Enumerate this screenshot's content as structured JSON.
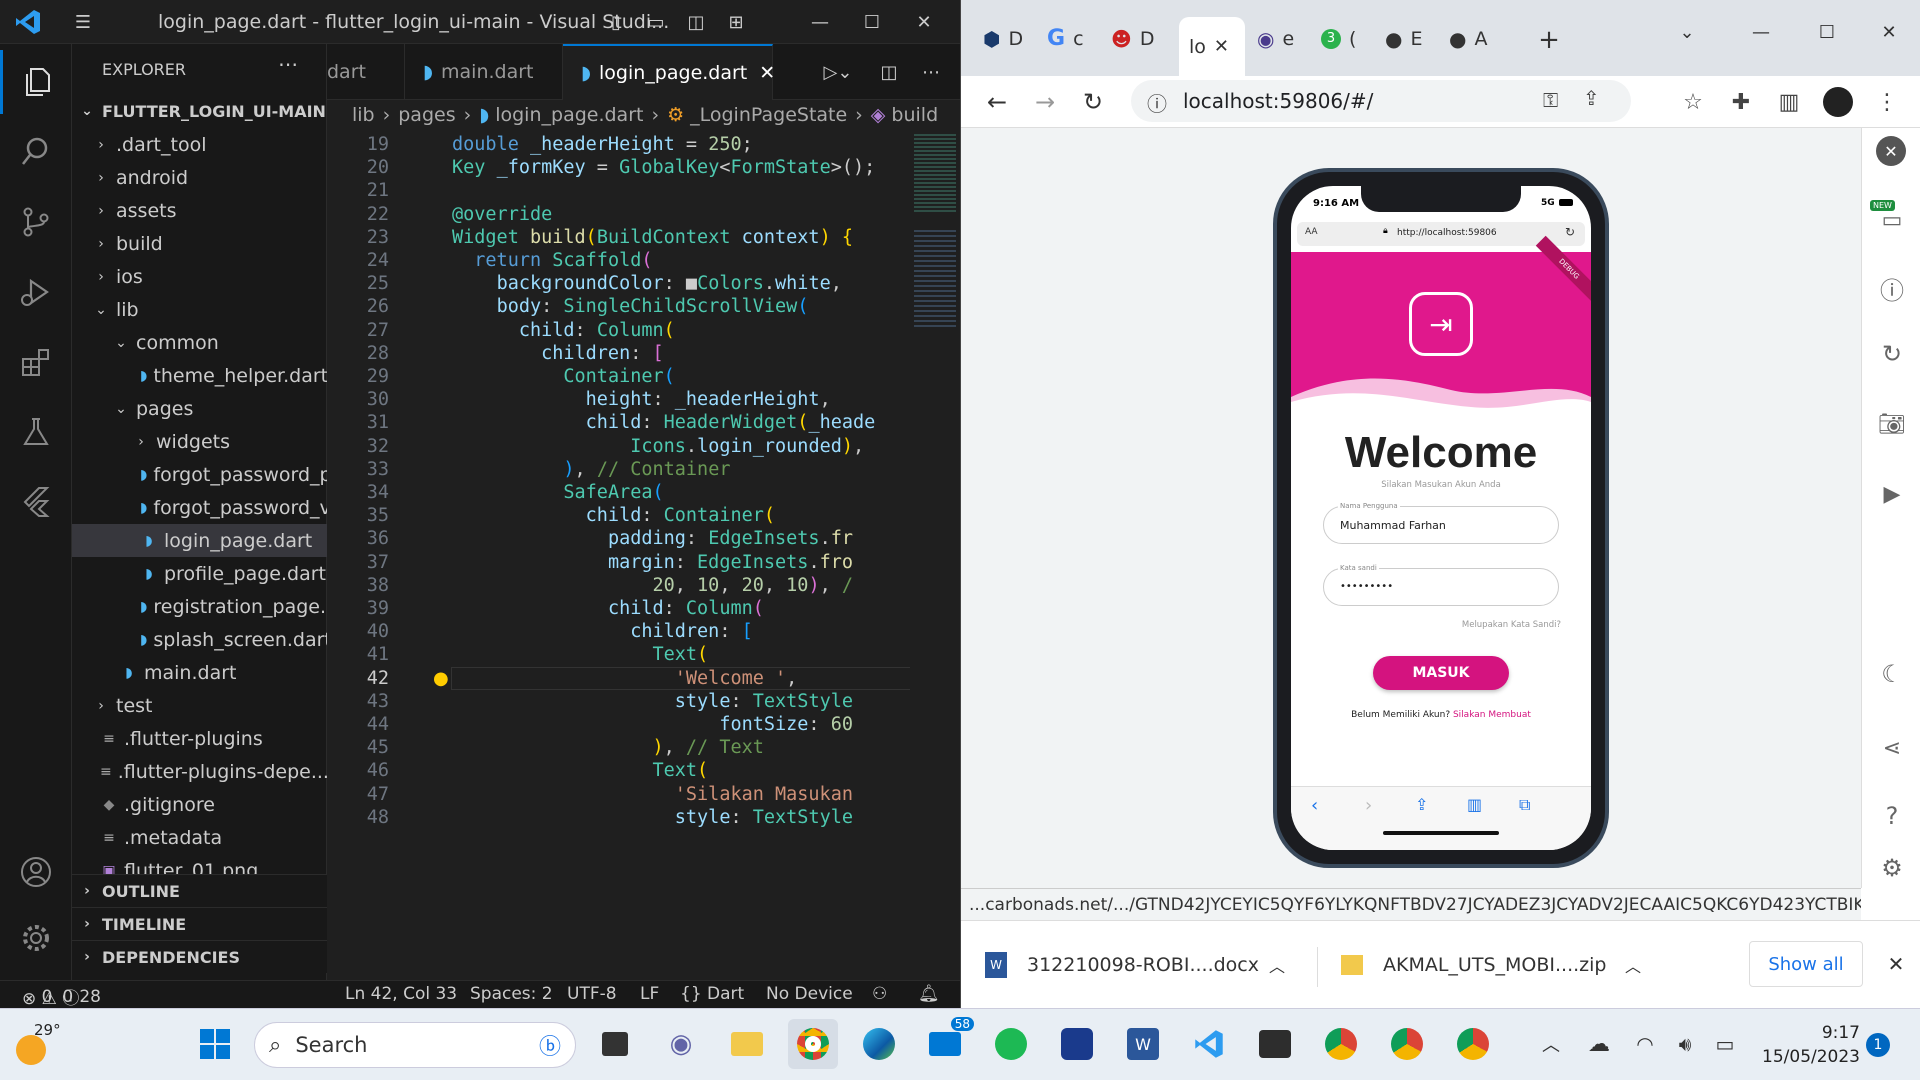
{
  "vscode": {
    "title": "login_page.dart - flutter_login_ui-main - Visual Studi...",
    "explorer_label": "EXPLORER",
    "project": "FLUTTER_LOGIN_UI-MAIN",
    "tree": [
      {
        "label": ".dart_tool",
        "type": "folder",
        "depth": 1,
        "open": false
      },
      {
        "label": "android",
        "type": "folder",
        "depth": 1,
        "open": false
      },
      {
        "label": "assets",
        "type": "folder",
        "depth": 1,
        "open": false
      },
      {
        "label": "build",
        "type": "folder",
        "depth": 1,
        "open": false
      },
      {
        "label": "ios",
        "type": "folder",
        "depth": 1,
        "open": false
      },
      {
        "label": "lib",
        "type": "folder",
        "depth": 1,
        "open": true
      },
      {
        "label": "common",
        "type": "folder",
        "depth": 2,
        "open": true
      },
      {
        "label": "theme_helper.dart",
        "type": "dart",
        "depth": 3
      },
      {
        "label": "pages",
        "type": "folder",
        "depth": 2,
        "open": true
      },
      {
        "label": "widgets",
        "type": "folder",
        "depth": 3,
        "open": false
      },
      {
        "label": "forgot_password_p...",
        "type": "dart",
        "depth": 3
      },
      {
        "label": "forgot_password_v...",
        "type": "dart",
        "depth": 3
      },
      {
        "label": "login_page.dart",
        "type": "dart",
        "depth": 3,
        "selected": true
      },
      {
        "label": "profile_page.dart",
        "type": "dart",
        "depth": 3
      },
      {
        "label": "registration_page....",
        "type": "dart",
        "depth": 3
      },
      {
        "label": "splash_screen.dart",
        "type": "dart",
        "depth": 3
      },
      {
        "label": "main.dart",
        "type": "dart",
        "depth": 2
      },
      {
        "label": "test",
        "type": "folder",
        "depth": 1,
        "open": false
      },
      {
        "label": ".flutter-plugins",
        "type": "file",
        "depth": 1
      },
      {
        "label": ".flutter-plugins-depe...",
        "type": "file",
        "depth": 1
      },
      {
        "label": ".gitignore",
        "type": "git",
        "depth": 1
      },
      {
        "label": ".metadata",
        "type": "file",
        "depth": 1
      },
      {
        "label": "flutter_01.png",
        "type": "image",
        "depth": 1
      }
    ],
    "sections": [
      "OUTLINE",
      "TIMELINE",
      "DEPENDENCIES"
    ],
    "tabs": [
      {
        "label": "dart",
        "active": false
      },
      {
        "label": "main.dart",
        "active": false
      },
      {
        "label": "login_page.dart",
        "active": true
      }
    ],
    "breadcrumb": [
      "lib",
      "pages",
      "login_page.dart",
      "_LoginPageState",
      "build"
    ],
    "code_lines": [
      {
        "n": "19",
        "html": "<span class='kw'>double</span> <span class='vr'>_headerHeight</span> = <span class='nm'>250</span>;"
      },
      {
        "n": "20",
        "html": "<span class='ty'>Key</span> <span class='vr'>_formKey</span> = <span class='ty'>GlobalKey</span>&lt;<span class='ty'>FormState</span>&gt;();"
      },
      {
        "n": "21",
        "html": ""
      },
      {
        "n": "22",
        "html": "<span class='ty'>@override</span>"
      },
      {
        "n": "23",
        "html": "<span class='ty'>Widget</span> <span class='fn'>build</span><span class='br1'>(</span><span class='ty'>BuildContext</span> <span class='vr'>context</span><span class='br1'>)</span> <span class='br1'>{</span>"
      },
      {
        "n": "24",
        "html": "  <span class='kw'>return</span> <span class='ty'>Scaffold</span><span class='br2'>(</span>"
      },
      {
        "n": "25",
        "html": "    <span class='vr'>backgroundColor</span>: ■<span class='ty'>Colors</span>.<span class='vr'>white</span>,"
      },
      {
        "n": "26",
        "html": "    <span class='vr'>body</span>: <span class='ty'>SingleChildScrollView</span><span class='br3'>(</span>"
      },
      {
        "n": "27",
        "html": "      <span class='vr'>child</span>: <span class='ty'>Column</span><span class='br1'>(</span>"
      },
      {
        "n": "28",
        "html": "        <span class='vr'>children</span>: <span class='br2'>[</span>"
      },
      {
        "n": "29",
        "html": "          <span class='ty'>Container</span><span class='br3'>(</span>"
      },
      {
        "n": "30",
        "html": "            <span class='vr'>height</span>: <span class='vr'>_headerHeight</span>,"
      },
      {
        "n": "31",
        "html": "            <span class='vr'>child</span>: <span class='ty'>HeaderWidget</span><span class='br1'>(</span><span class='vr'>_heade</span>"
      },
      {
        "n": "32",
        "html": "                <span class='ty'>Icons</span>.<span class='vr'>login_rounded</span><span class='br1'>)</span>,"
      },
      {
        "n": "33",
        "html": "          <span class='br3'>)</span>, <span class='cm'>// Container</span>"
      },
      {
        "n": "34",
        "html": "          <span class='ty'>SafeArea</span><span class='br3'>(</span>"
      },
      {
        "n": "35",
        "html": "            <span class='vr'>child</span>: <span class='ty'>Container</span><span class='br1'>(</span>"
      },
      {
        "n": "36",
        "html": "              <span class='vr'>padding</span>: <span class='ty'>EdgeInsets</span>.<span class='fn'>fr</span>"
      },
      {
        "n": "37",
        "html": "              <span class='vr'>margin</span>: <span class='ty'>EdgeInsets</span>.<span class='fn'>fro</span>"
      },
      {
        "n": "38",
        "html": "                  <span class='nm'>20</span>, <span class='nm'>10</span>, <span class='nm'>20</span>, <span class='nm'>10</span><span class='br2'>)</span>, <span class='cm'>/</span>"
      },
      {
        "n": "39",
        "html": "              <span class='vr'>child</span>: <span class='ty'>Column</span><span class='br2'>(</span>"
      },
      {
        "n": "40",
        "html": "                <span class='vr'>children</span>: <span class='br3'>[</span>"
      },
      {
        "n": "41",
        "html": "                  <span class='ty'>Text</span><span class='br1'>(</span>"
      },
      {
        "n": "42",
        "html": "                    <span class='st'>'Welcome '</span>,"
      },
      {
        "n": "43",
        "html": "                    <span class='vr'>style</span>: <span class='ty'>TextStyle</span>"
      },
      {
        "n": "44",
        "html": "                        <span class='vr'>fontSize</span>: <span class='nm'>60</span>"
      },
      {
        "n": "45",
        "html": "                  <span class='br1'>)</span>, <span class='cm'>// Text</span>"
      },
      {
        "n": "46",
        "html": "                  <span class='ty'>Text</span><span class='br1'>(</span>"
      },
      {
        "n": "47",
        "html": "                    <span class='st'>'Silakan Masukan</span>"
      },
      {
        "n": "48",
        "html": "                    <span class='vr'>style</span>: <span class='ty'>TextStyle</span>"
      }
    ],
    "current_line": "42",
    "status": {
      "errors": "0",
      "warnings": "0",
      "info": "28",
      "position": "Ln 42, Col 33",
      "spaces": "Spaces: 2",
      "encoding": "UTF-8",
      "eol": "LF",
      "language": "{} Dart",
      "device": "No Device"
    }
  },
  "chrome": {
    "tabs": [
      {
        "label": "D",
        "icon": "app-icon"
      },
      {
        "label": "c",
        "icon": "google-icon"
      },
      {
        "label": "D",
        "icon": "emoji-icon"
      },
      {
        "label": "lo",
        "icon": "",
        "active": true
      },
      {
        "label": "e",
        "icon": "avatar-icon"
      },
      {
        "label": "(",
        "icon": "badge-3-icon"
      },
      {
        "label": "E",
        "icon": "github-icon"
      },
      {
        "label": "A",
        "icon": "github-icon"
      }
    ],
    "url": "localhost:59806/#/",
    "status_url": "...carbonads.net/.../GTND42JYCEYIC5QYF6YLYKQNFTBDV27JCYADEZ3JCYADV2JECAAIC5QKC6YD423YCTBIKKQE...",
    "downloads": [
      {
        "name": "312210098-ROBI....docx",
        "icon": "word-icon"
      },
      {
        "name": "AKMAL_UTS_MOBI....zip",
        "icon": "zip-icon"
      }
    ],
    "show_all": "Show all"
  },
  "phone": {
    "time": "9:16 AM",
    "network": "5G",
    "address": "http://localhost:59806",
    "aa_label": "AA",
    "debug": "DEBUG",
    "welcome": "Welcome",
    "subtitle": "Silakan Masukan Akun Anda",
    "username_label": "Nama Pengguna",
    "username_value": "Muhammad Farhan",
    "password_label": "Kata sandi",
    "password_value": "•••••••••",
    "forgot": "Melupakan Kata Sandi?",
    "login_button": "MASUK",
    "no_account": "Belum Memiliki Akun?",
    "register_link": "Silakan Membuat",
    "primary_color": "#e0188c",
    "header_color": "#d4137f"
  },
  "taskbar": {
    "temperature": "29°",
    "search": "Search",
    "mail_badge": "58",
    "time": "9:17",
    "date": "15/05/2023",
    "notification_count": "1"
  }
}
